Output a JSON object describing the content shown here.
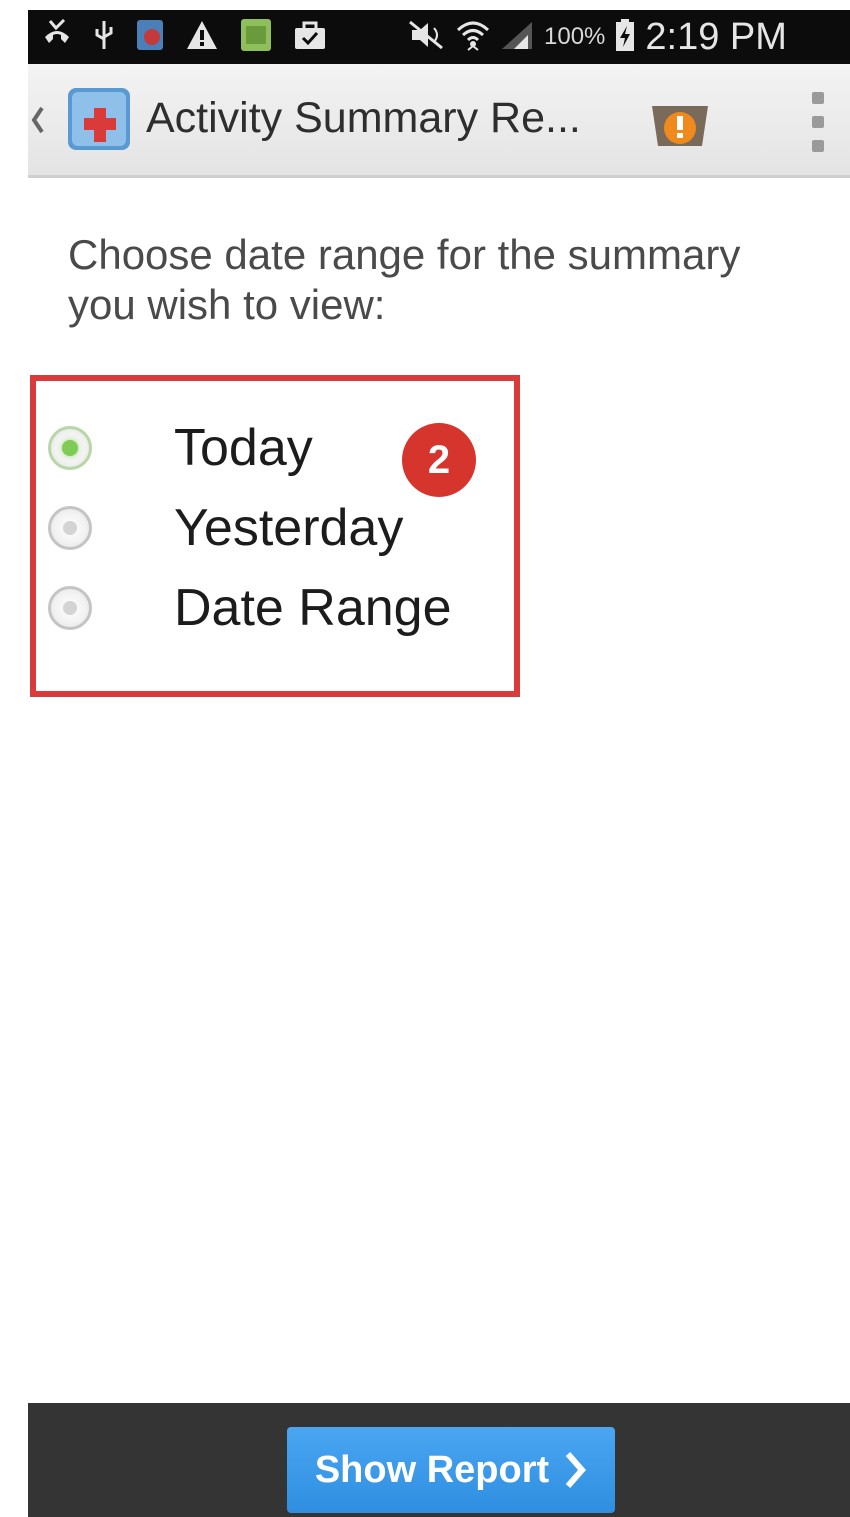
{
  "status_bar": {
    "time": "2:19 PM",
    "battery_percent": "100%",
    "icons": [
      "missed-call-icon",
      "usb-icon",
      "app-notification-icon",
      "warning-icon",
      "image-icon",
      "bag-icon",
      "mute-icon",
      "wifi-icon",
      "signal-icon",
      "battery-charging-icon"
    ]
  },
  "action_bar": {
    "title": "Activity Summary Re...",
    "icons": [
      "back-chevron-icon",
      "app-icon",
      "alert-icon",
      "overflow-menu-icon"
    ]
  },
  "content": {
    "prompt": "Choose date range for the summary you wish to view:",
    "options": [
      {
        "label": "Today",
        "selected": true
      },
      {
        "label": "Yesterday",
        "selected": false
      },
      {
        "label": "Date Range",
        "selected": false
      }
    ],
    "step_badge": "2"
  },
  "colors": {
    "highlight": "#d93a3a",
    "button": "#3a9cec",
    "radio_selected": "#7ecb55",
    "bottom_bar": "#343434"
  },
  "bottom_bar": {
    "button_label": "Show Report"
  }
}
